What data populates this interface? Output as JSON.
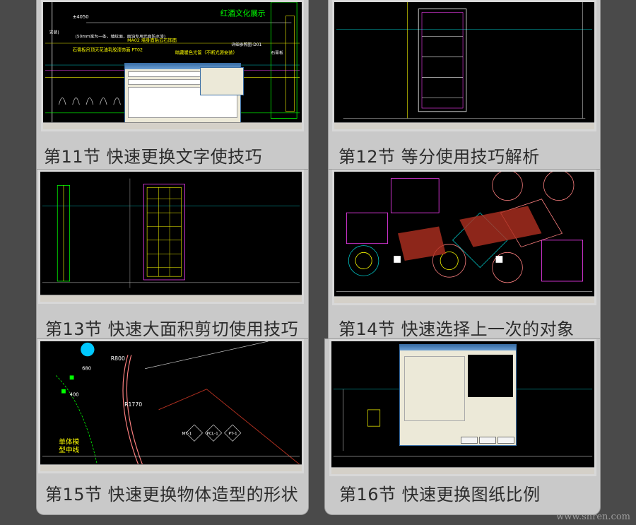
{
  "lessons": [
    {
      "label": "第11节 快速更换文字使技巧",
      "drawing_text": [
        "红酒文化展示",
        "MA02 墙身面贴云石饰面",
        "石膏板吊顶天花油乳胶漆饰面 PT02",
        "暗藏暖色光管（不断光源安装）",
        "(50mm宽为一条，墙纹面，面油专用光面防水漆)",
        "详细参照图-D01",
        "石膏板",
        "安装)"
      ]
    },
    {
      "label": "第12节 等分使用技巧解析"
    },
    {
      "label": "第13节 快速大面积剪切使用技巧"
    },
    {
      "label": "第14节 快速选择上一次的对象"
    },
    {
      "label": "第15节 快速更换物体造型的形状",
      "drawing_text": [
        "R800",
        "R1770",
        "MT-1",
        "PCL-1",
        "PT-1",
        "单体模",
        "型中线",
        "680",
        "400"
      ]
    },
    {
      "label": "第16节 快速更换图纸比例"
    }
  ],
  "watermark": "www.snren.com"
}
